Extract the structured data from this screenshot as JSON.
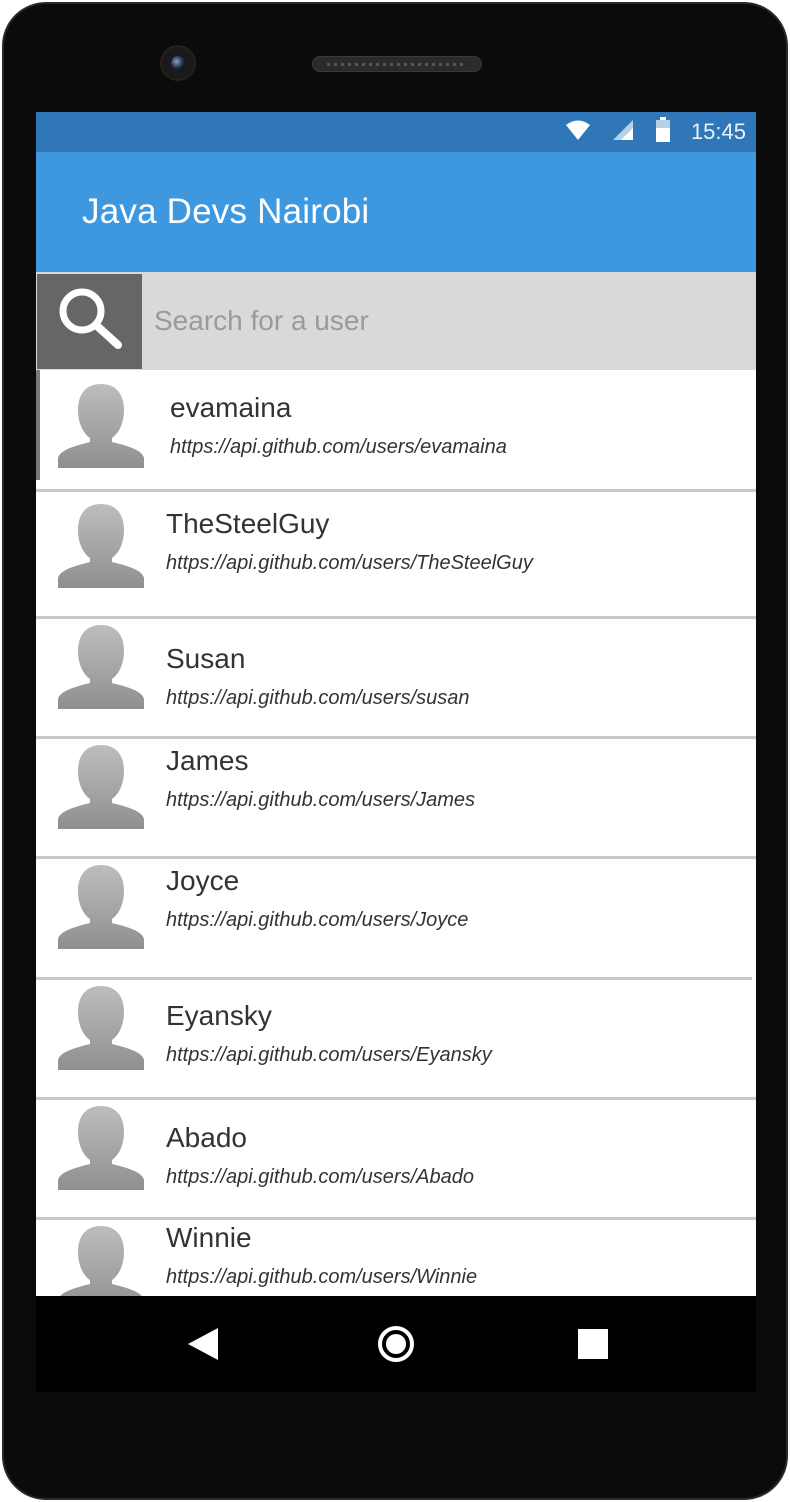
{
  "status_bar": {
    "time": "15:45",
    "icons": [
      "wifi-icon",
      "signal-icon",
      "battery-icon"
    ]
  },
  "app_bar": {
    "title": "Java Devs Nairobi",
    "color": "#3d98e0"
  },
  "search": {
    "placeholder": "Search for a user",
    "value": "",
    "icon": "search-icon"
  },
  "users": [
    {
      "login": "evamaina",
      "url": "https://api.github.com/users/evamaina"
    },
    {
      "login": "TheSteelGuy",
      "url": "https://api.github.com/users/TheSteelGuy"
    },
    {
      "login": "Susan",
      "url": "https://api.github.com/users/susan"
    },
    {
      "login": "James",
      "url": "https://api.github.com/users/James"
    },
    {
      "login": "Joyce",
      "url": "https://api.github.com/users/Joyce"
    },
    {
      "login": "Eyansky",
      "url": "https://api.github.com/users/Eyansky"
    },
    {
      "login": "Abado",
      "url": "https://api.github.com/users/Abado"
    },
    {
      "login": "Winnie",
      "url": "https://api.github.com/users/Winnie"
    }
  ],
  "nav_bar": {
    "icons": [
      "back-icon",
      "home-icon",
      "recents-icon"
    ]
  }
}
